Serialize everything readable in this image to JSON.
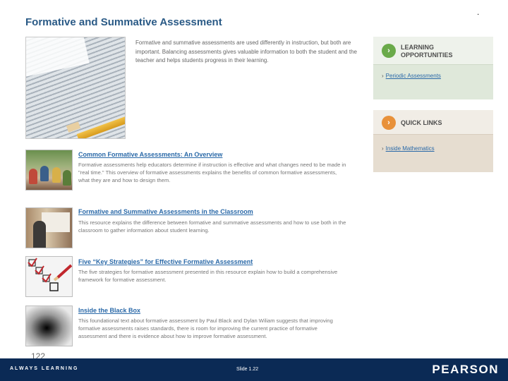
{
  "page": {
    "title": "Formative and Summative Assessment",
    "corner_mark": "."
  },
  "intro": {
    "text": "Formative and summative assessments are used differently in instruction, but both are important. Balancing assessments gives valuable information to both the student and the teacher and helps students progress in their learning."
  },
  "articles": [
    {
      "title": "Common Formative Assessments: An Overview",
      "description": "Formative assessments help educators determine if instruction is effective and what changes need to be made in \"real time.\" This overview of formative assessments explains the benefits of common formative assessments, what they are and how to design them."
    },
    {
      "title": "Formative and Summative Assessments in the Classroom",
      "description": "This resource explains the difference between formative and summative assessments and how to use both in the classroom to gather information about student learning."
    },
    {
      "title": "Five “Key Strategies” for Effective Formative Assessment",
      "description": "The five strategies for formative assessment presented in this resource explain how to build a comprehensive framework for formative assessment."
    },
    {
      "title": "Inside the Black Box",
      "description": "This foundational text about formative assessment by Paul Black and Dylan Wiliam suggests that improving formative assessments raises standards, there is room for improving the current practice of formative assessment and there is evidence about how to improve formative assessment."
    }
  ],
  "sidebar": {
    "learning": {
      "line1": "LEARNING",
      "line2": "OPPORTUNITIES",
      "icon": "play-circle-icon",
      "accent": "#6aaa4a",
      "link": "Periodic Assessments"
    },
    "quick": {
      "label": "QUICK LINKS",
      "icon": "arrow-circle-icon",
      "accent": "#e8913a",
      "link": "Inside Mathematics"
    }
  },
  "footer": {
    "tagline": "ALWAYS LEARNING",
    "slide": "Slide 1.22",
    "brand": "PEARSON",
    "ghost_number": "122"
  },
  "colors": {
    "footer_bg": "#0b2a55",
    "title": "#2a5a86",
    "link": "#2a69a8"
  }
}
